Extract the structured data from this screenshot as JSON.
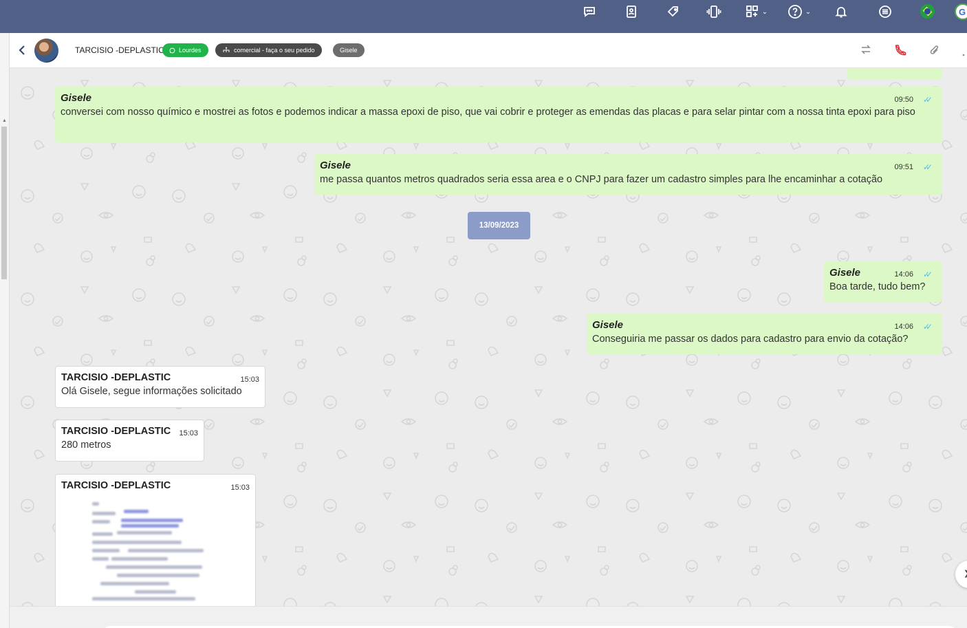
{
  "topbar": {
    "icons": [
      "chat-bubble-icon",
      "contact-card-icon",
      "tag-icon",
      "phone-vibrate-icon",
      "apps-grid-icon",
      "help-icon",
      "bell-icon",
      "menu-list-icon"
    ],
    "language_flag": "brazil-flag",
    "user_initial": "G"
  },
  "header": {
    "contact_name": "TARCISIO -DEPLASTIC",
    "channel_chip": "Lourdes",
    "queue_chip": "comercial - faça o seu pedido",
    "agent_chip": "Gisele",
    "colors": {
      "channel": "#22b24c",
      "queue": "#4a4a4a",
      "agent": "#6d6d6d"
    }
  },
  "messages": [
    {
      "direction": "out",
      "sender": "Gisele",
      "time": "09:50",
      "text": "conversei com nosso químico e mostrei as fotos e podemos indicar a massa epoxi de piso, que vai cobrir e proteger as emendas das placas e para selar pintar com a nossa tinta epoxi para piso"
    },
    {
      "direction": "out",
      "sender": "Gisele",
      "time": "09:51",
      "text": "me passa quantos metros quadrados seria essa area e o CNPJ para fazer um cadastro simples para lhe encaminhar a cotação"
    },
    {
      "date_separator": "13/09/2023"
    },
    {
      "direction": "out",
      "sender": "Gisele",
      "time": "14:06",
      "text": "Boa tarde, tudo bem?"
    },
    {
      "direction": "out",
      "sender": "Gisele",
      "time": "14:06",
      "text": "Conseguiria me passar os dados para cadastro para envio da cotação?"
    },
    {
      "direction": "in",
      "sender": "TARCISIO -DEPLASTIC",
      "time": "15:03",
      "text": "Olá Gisele, segue informações solicitado"
    },
    {
      "direction": "in",
      "sender": "TARCISIO -DEPLASTIC",
      "time": "15:03",
      "text": "280 metros"
    },
    {
      "direction": "in",
      "sender": "TARCISIO -DEPLASTIC",
      "time": "15:03",
      "attachment": "document-image"
    }
  ],
  "colors": {
    "topbar": "#506087",
    "outgoing_bubble": "#dcf8c6",
    "incoming_bubble": "#ffffff",
    "read_ticks": "#53bdeb",
    "date_chip": "#8c9cc9"
  }
}
